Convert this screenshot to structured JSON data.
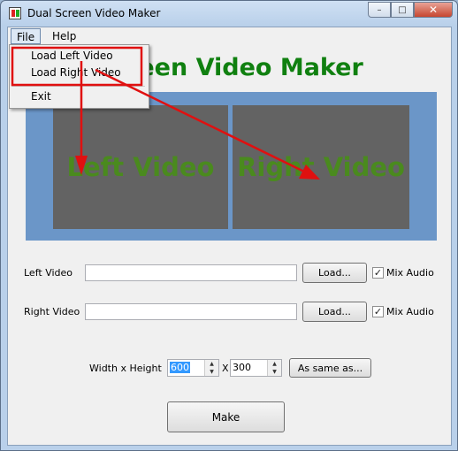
{
  "window": {
    "title": "Dual Screen Video Maker"
  },
  "titlebar_buttons": {
    "minimize": "–",
    "maximize": "□",
    "close": "✕"
  },
  "menu": {
    "file": "File",
    "help": "Help"
  },
  "file_menu": {
    "load_left": "Load Left Video",
    "load_right": "Load Right Video",
    "exit": "Exit"
  },
  "headline": "creen Video Maker",
  "preview": {
    "left": "Left Video",
    "right": "Right Video"
  },
  "left_video": {
    "label": "Left Video",
    "value": "",
    "load_button": "Load...",
    "mix_audio_label": "Mix Audio",
    "mix_audio_checked": true
  },
  "right_video": {
    "label": "Right Video",
    "value": "",
    "load_button": "Load...",
    "mix_audio_label": "Mix Audio",
    "mix_audio_checked": true
  },
  "size": {
    "label": "Width x Height",
    "width": "600",
    "separator": "X",
    "height": "300",
    "same_as_button": "As same as..."
  },
  "make_button": "Make",
  "colors": {
    "headline": "#108010",
    "preview_bg": "#6b96c8",
    "video_bg": "#636363",
    "video_text": "#4a8a1e",
    "annotation": "#e01010"
  },
  "icons": {
    "checkbox": "✓",
    "spin_up": "▲",
    "spin_down": "▼"
  }
}
